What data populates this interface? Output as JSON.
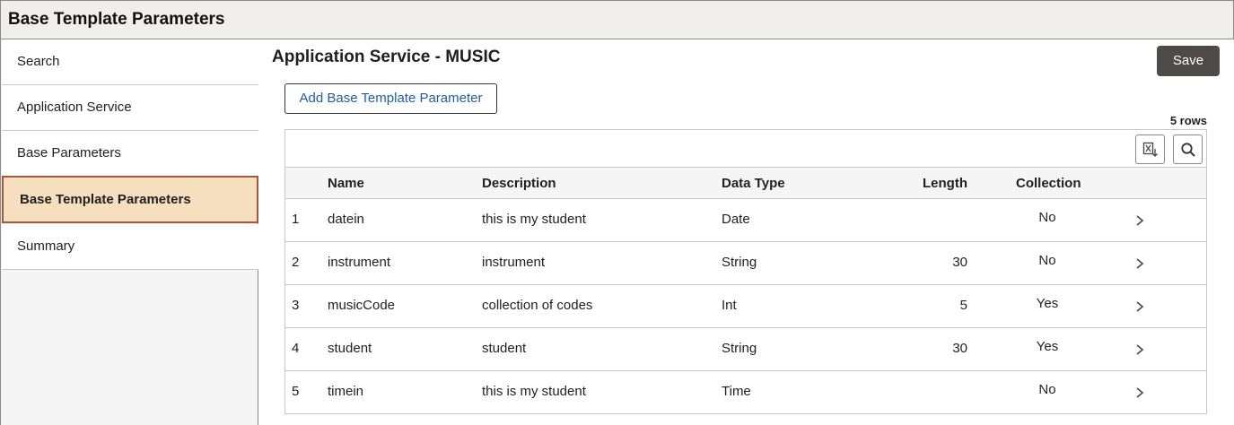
{
  "header": {
    "title": "Base Template Parameters"
  },
  "sidebar": {
    "items": [
      {
        "label": "Search"
      },
      {
        "label": "Application Service"
      },
      {
        "label": "Base Parameters"
      },
      {
        "label": "Base Template Parameters",
        "active": true
      },
      {
        "label": "Summary"
      }
    ]
  },
  "main": {
    "title": "Application Service - MUSIC",
    "save_label": "Save",
    "add_label": "Add Base Template Parameter",
    "rows_label": "5 rows",
    "toolbar_icons": [
      "export-icon",
      "search-icon"
    ],
    "columns": [
      "Name",
      "Description",
      "Data Type",
      "Length",
      "Collection"
    ],
    "rows": [
      {
        "num": "1",
        "name": "datein",
        "description": "this is my student",
        "data_type": "Date",
        "length": "",
        "collection": "No"
      },
      {
        "num": "2",
        "name": "instrument",
        "description": "instrument",
        "data_type": "String",
        "length": "30",
        "collection": "No"
      },
      {
        "num": "3",
        "name": "musicCode",
        "description": "collection of codes",
        "data_type": "Int",
        "length": "5",
        "collection": "Yes"
      },
      {
        "num": "4",
        "name": "student",
        "description": "student",
        "data_type": "String",
        "length": "30",
        "collection": "Yes"
      },
      {
        "num": "5",
        "name": "timein",
        "description": "this is my student",
        "data_type": "Time",
        "length": "",
        "collection": "No"
      }
    ]
  },
  "colors": {
    "accent_active_bg": "#f6dfbf",
    "accent_active_border": "#a05a3a",
    "save_bg": "#4e4a47",
    "link": "#1f5fa0"
  }
}
